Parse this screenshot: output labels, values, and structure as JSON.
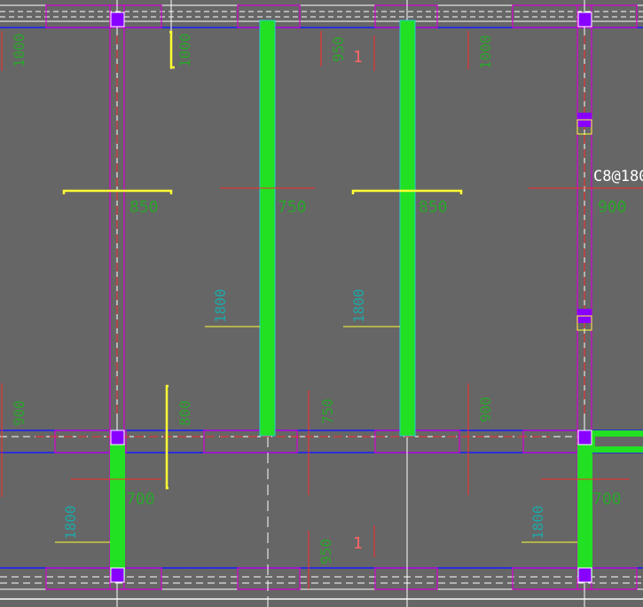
{
  "drawing": {
    "colors": {
      "background": "#666666",
      "beam": "#d400d4",
      "axis_blue": "#1a1aff",
      "rebar_green": "#22e022",
      "rebar_edge": "#20d0d0",
      "section_red": "#ff2a2a",
      "bracket_yellow": "#ffff33",
      "text_green": "#2aa52a",
      "text_cyan": "#1fa6a6",
      "column_fill": "#8800ff",
      "frame_white": "#ffffff"
    },
    "dimensions": {
      "d1000_a": "1000",
      "d1000_b": "1000",
      "d950_top": "950",
      "d1000_c": "1000",
      "d850_a": "850",
      "d750_mid": "750",
      "d850_b": "850",
      "d900_right": "900",
      "d1800_a": "1800",
      "d1800_b": "1800",
      "d900_left": "900",
      "d800": "800",
      "d750_low": "750",
      "d900_low": "900",
      "d700_a": "700",
      "d1800_c": "1800",
      "d950_bot": "950",
      "d1800_d": "1800",
      "d700_b": "700"
    },
    "marks": {
      "mark_top": "1",
      "mark_bot": "1"
    },
    "rebar_label": "C8@180"
  }
}
